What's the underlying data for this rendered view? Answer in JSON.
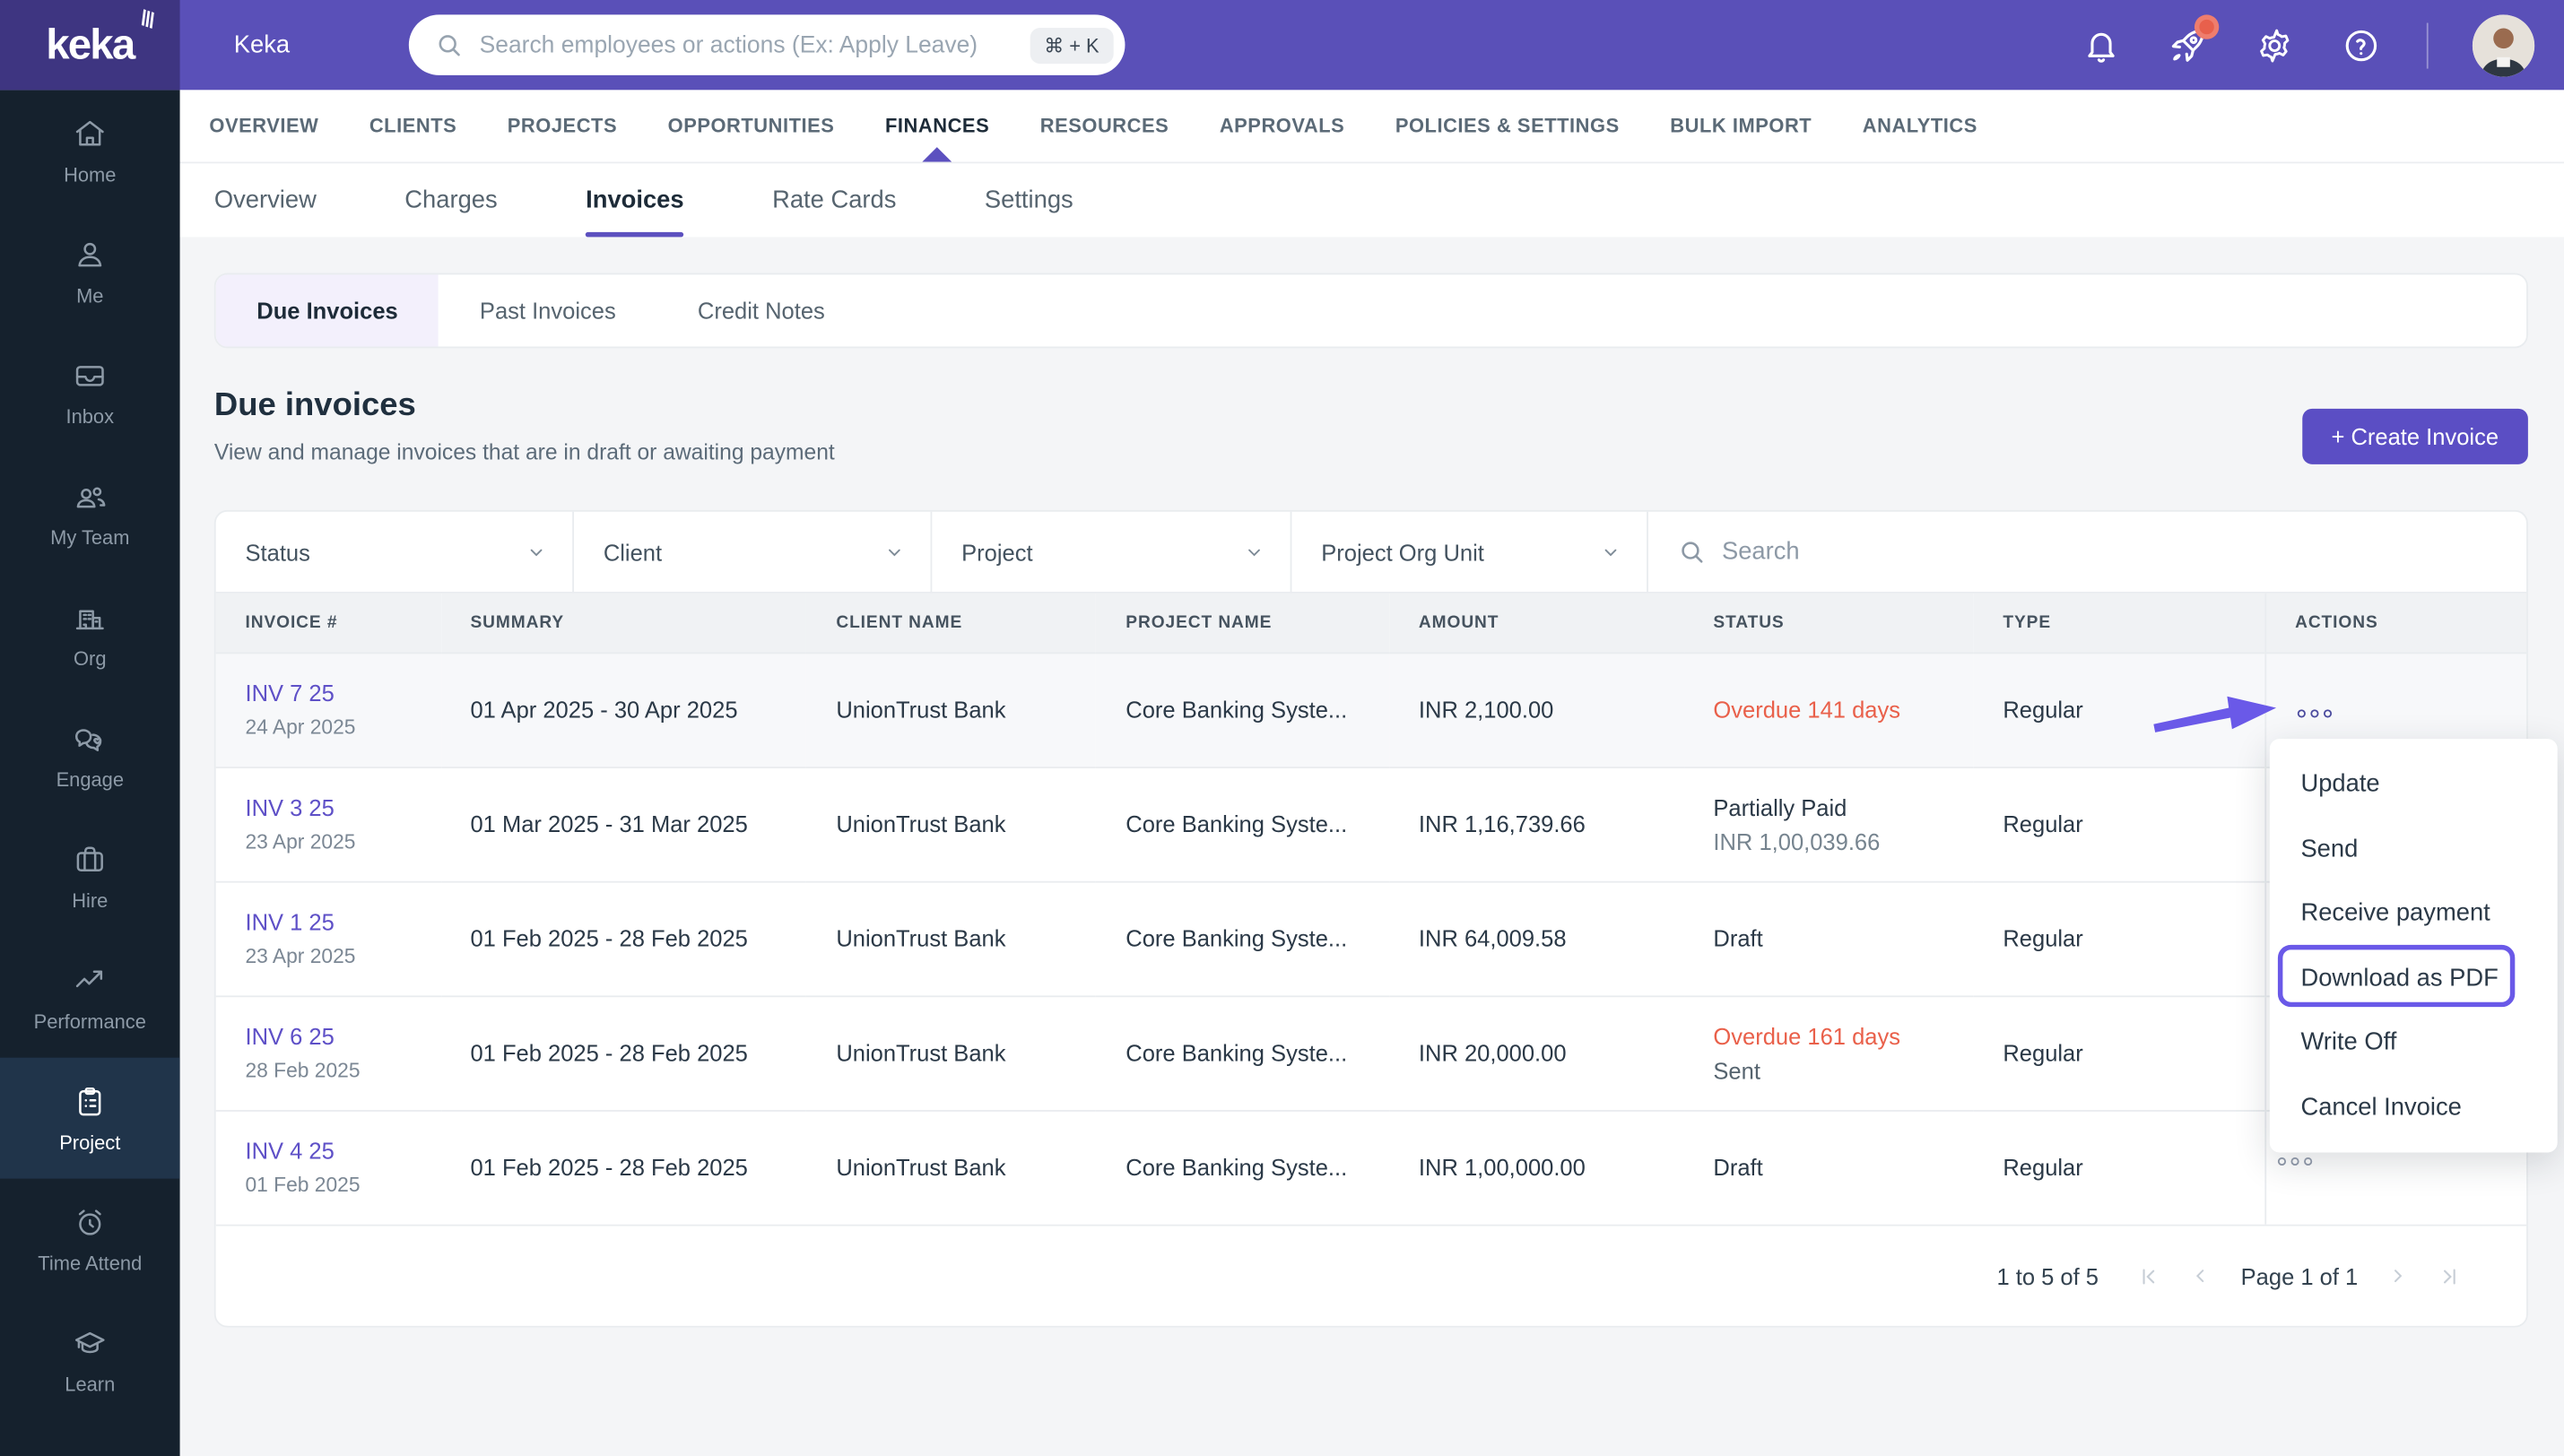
{
  "brand": {
    "logo_text": "keka",
    "app_title": "Keka"
  },
  "header": {
    "search_placeholder": "Search employees or actions (Ex: Apply Leave)",
    "search_shortcut": "⌘ + K"
  },
  "main_nav": {
    "items": [
      "OVERVIEW",
      "CLIENTS",
      "PROJECTS",
      "OPPORTUNITIES",
      "FINANCES",
      "RESOURCES",
      "APPROVALS",
      "POLICIES & SETTINGS",
      "BULK IMPORT",
      "ANALYTICS"
    ],
    "active": "FINANCES"
  },
  "sub_nav": {
    "items": [
      "Overview",
      "Charges",
      "Invoices",
      "Rate Cards",
      "Settings"
    ],
    "active": "Invoices"
  },
  "sidebar": {
    "items": [
      {
        "icon": "home-icon",
        "label": "Home"
      },
      {
        "icon": "me-icon",
        "label": "Me"
      },
      {
        "icon": "inbox-icon",
        "label": "Inbox"
      },
      {
        "icon": "my-team-icon",
        "label": "My Team"
      },
      {
        "icon": "org-icon",
        "label": "Org"
      },
      {
        "icon": "engage-icon",
        "label": "Engage"
      },
      {
        "icon": "hire-icon",
        "label": "Hire"
      },
      {
        "icon": "performance-icon",
        "label": "Performance"
      },
      {
        "icon": "project-icon",
        "label": "Project"
      },
      {
        "icon": "time-attend-icon",
        "label": "Time Attend"
      },
      {
        "icon": "learn-icon",
        "label": "Learn"
      }
    ],
    "active": "Project"
  },
  "page": {
    "tabs": [
      "Due Invoices",
      "Past Invoices",
      "Credit Notes"
    ],
    "active_tab": "Due Invoices",
    "title": "Due invoices",
    "subtitle": "View and manage invoices that are in draft or awaiting payment",
    "create_button": "+ Create Invoice"
  },
  "filters": {
    "dropdowns": [
      "Status",
      "Client",
      "Project",
      "Project Org Unit"
    ],
    "search_placeholder": "Search"
  },
  "table": {
    "columns": [
      "INVOICE #",
      "SUMMARY",
      "CLIENT NAME",
      "PROJECT NAME",
      "AMOUNT",
      "STATUS",
      "TYPE",
      "ACTIONS"
    ],
    "rows": [
      {
        "invoice": "INV 7 25",
        "date": "24 Apr 2025",
        "summary": "01 Apr 2025 - 30 Apr 2025",
        "client": "UnionTrust Bank",
        "project": "Core Banking Syste...",
        "amount": "INR 2,100.00",
        "status": "Overdue 141 days",
        "status_sub": "",
        "type": "Regular"
      },
      {
        "invoice": "INV 3 25",
        "date": "23 Apr 2025",
        "summary": "01 Mar 2025 - 31 Mar 2025",
        "client": "UnionTrust Bank",
        "project": "Core Banking Syste...",
        "amount": "INR 1,16,739.66",
        "status": "Partially Paid",
        "status_sub": "INR 1,00,039.66",
        "type": "Regular"
      },
      {
        "invoice": "INV 1 25",
        "date": "23 Apr 2025",
        "summary": "01 Feb 2025 - 28 Feb 2025",
        "client": "UnionTrust Bank",
        "project": "Core Banking Syste...",
        "amount": "INR 64,009.58",
        "status": "Draft",
        "status_sub": "",
        "type": "Regular"
      },
      {
        "invoice": "INV 6 25",
        "date": "28 Feb 2025",
        "summary": "01 Feb 2025 - 28 Feb 2025",
        "client": "UnionTrust Bank",
        "project": "Core Banking Syste...",
        "amount": "INR 20,000.00",
        "status": "Overdue 161 days",
        "status_sub": "Sent",
        "type": "Regular"
      },
      {
        "invoice": "INV 4 25",
        "date": "01 Feb 2025",
        "summary": "01 Feb 2025 - 28 Feb 2025",
        "client": "UnionTrust Bank",
        "project": "Core Banking Syste...",
        "amount": "INR 1,00,000.00",
        "status": "Draft",
        "status_sub": "",
        "type": "Regular"
      }
    ]
  },
  "context_menu": {
    "items": [
      "Update",
      "Send",
      "Receive payment",
      "Download as PDF",
      "Write Off",
      "Cancel Invoice"
    ],
    "highlighted": "Download as PDF"
  },
  "pagination": {
    "range": "1 to 5 of 5",
    "page": "Page 1 of 1"
  },
  "colors": {
    "header_purple": "#5a50b8",
    "logo_purple": "#3e3581",
    "sidebar_navy": "#15212d",
    "accent_purple": "#5c50bf",
    "button_purple": "#5b4ec4",
    "link_purple": "#5e50c7",
    "overdue_red": "#e9604a",
    "annotation_purple": "#6a59e8",
    "notification_red": "#e8604c"
  }
}
